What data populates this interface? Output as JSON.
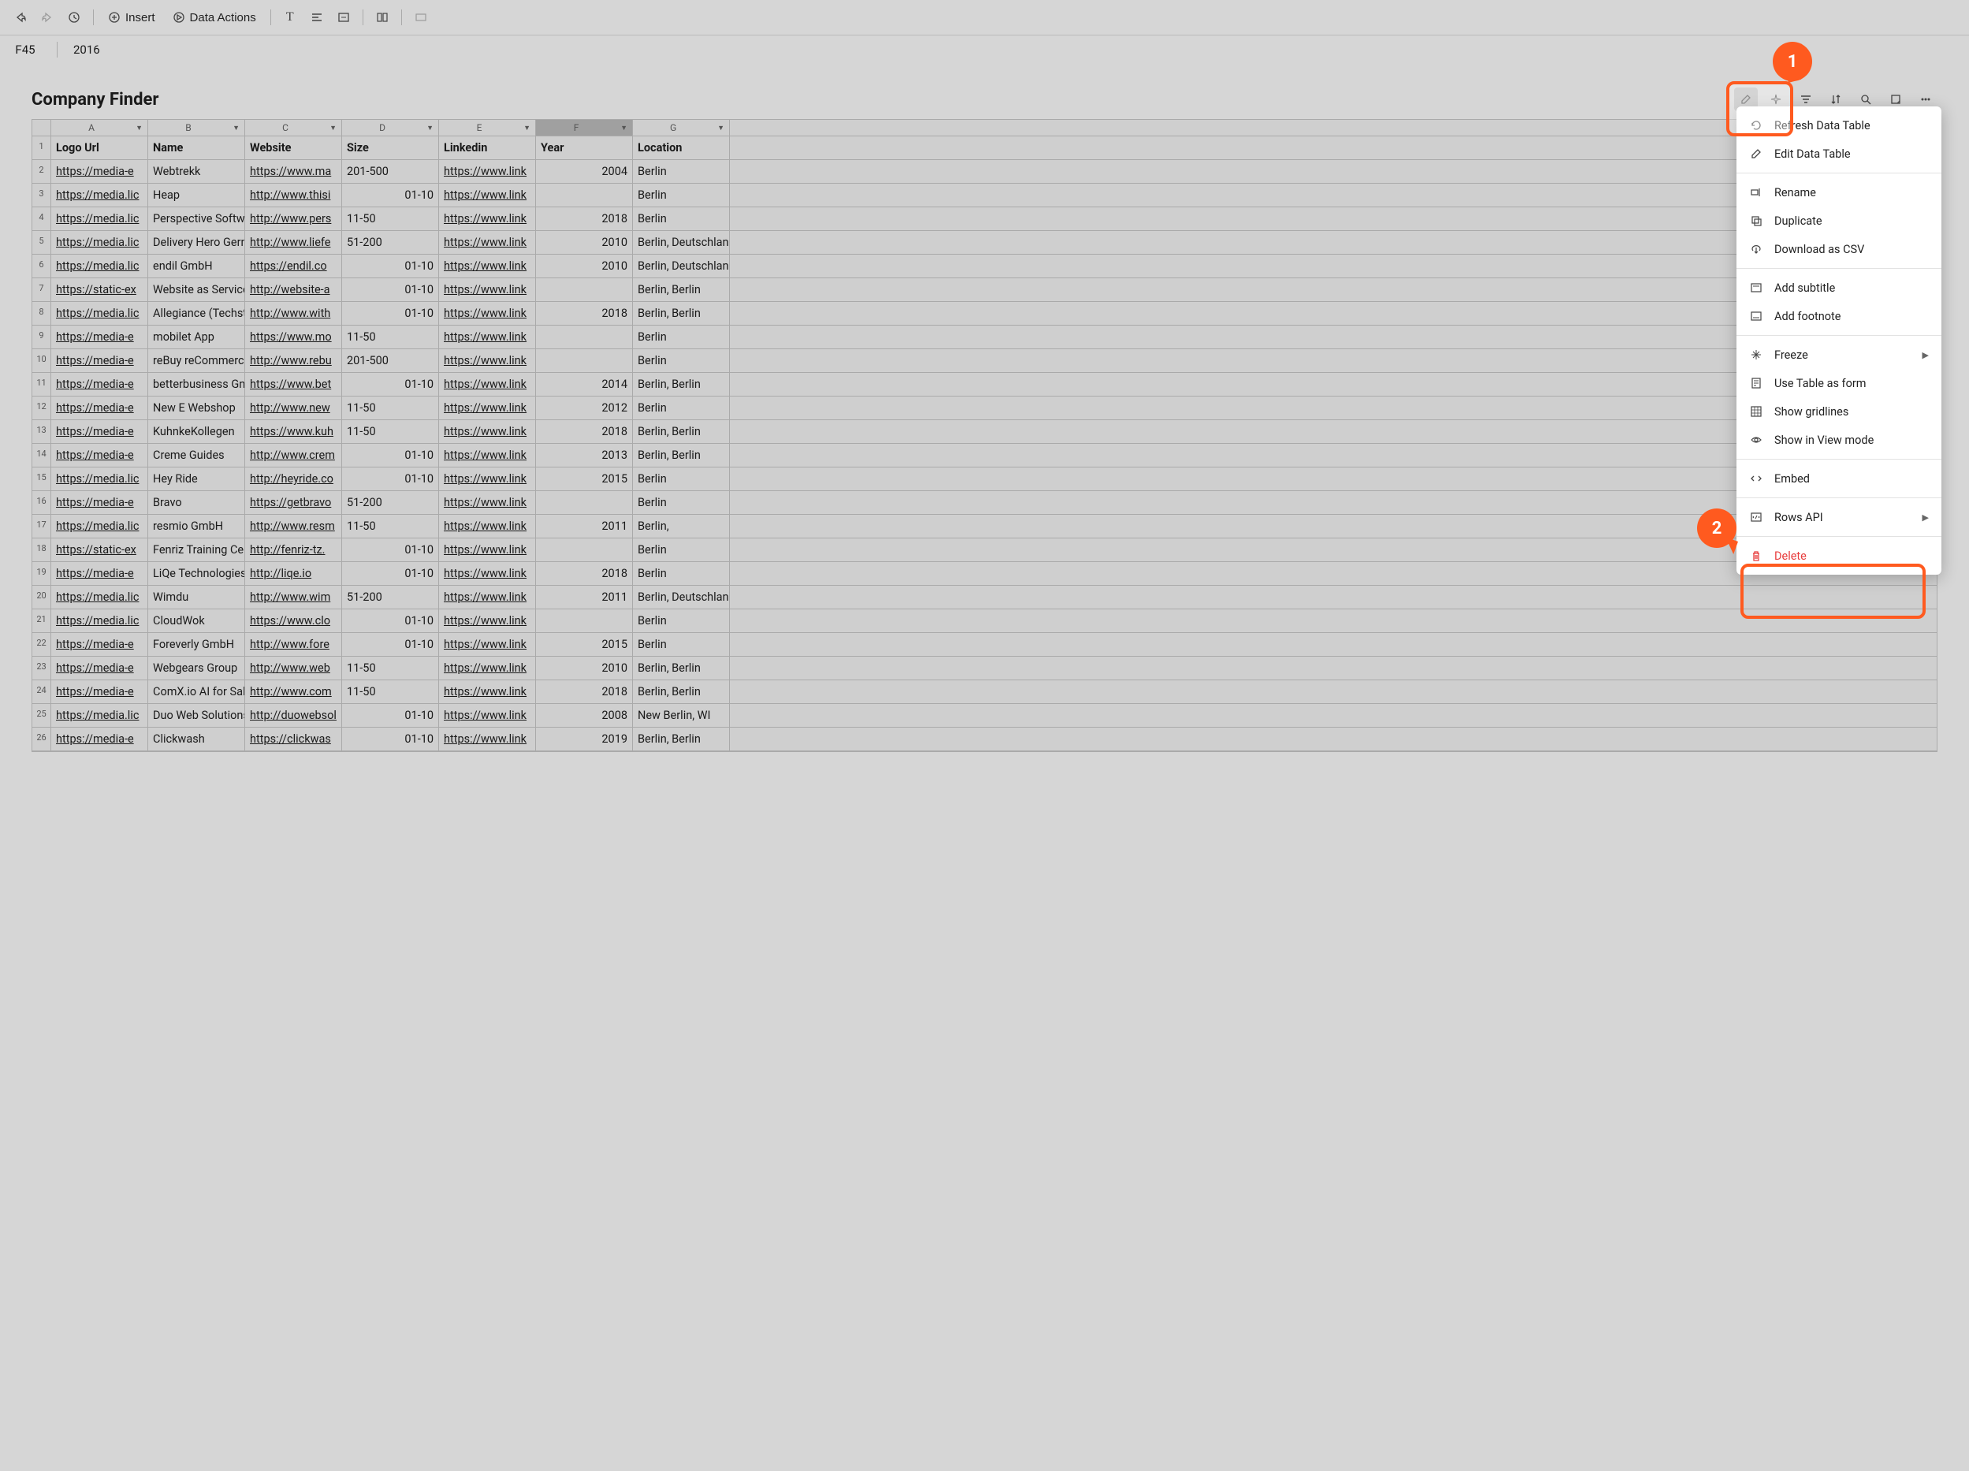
{
  "toolbar": {
    "insert_label": "Insert",
    "data_actions_label": "Data Actions"
  },
  "cell_ref": {
    "ref": "F45",
    "value": "2016"
  },
  "table": {
    "title": "Company Finder",
    "columns": [
      "A",
      "B",
      "C",
      "D",
      "E",
      "F",
      "G"
    ],
    "selected_column": "F",
    "headers": [
      "Logo Url",
      "Name",
      "Website",
      "Size",
      "Linkedin",
      "Year",
      "Location"
    ],
    "rows": [
      {
        "num": 2,
        "logo": "https://media-e",
        "name": "Webtrekk",
        "website": "https://www.ma",
        "size": "201-500",
        "linkedin": "https://www.link",
        "year": "2004",
        "location": "Berlin"
      },
      {
        "num": 3,
        "logo": "https://media.lic",
        "name": "Heap",
        "website": "http://www.thisi",
        "size": "01-10",
        "linkedin": "https://www.link",
        "year": "",
        "location": "Berlin"
      },
      {
        "num": 4,
        "logo": "https://media.lic",
        "name": "Perspective Softw",
        "website": "http://www.pers",
        "size": "11-50",
        "linkedin": "https://www.link",
        "year": "2018",
        "location": "Berlin"
      },
      {
        "num": 5,
        "logo": "https://media.lic",
        "name": "Delivery Hero Gern",
        "website": "http://www.liefe",
        "size": "51-200",
        "linkedin": "https://www.link",
        "year": "2010",
        "location": "Berlin, Deutschlan"
      },
      {
        "num": 6,
        "logo": "https://media.lic",
        "name": "endil GmbH",
        "website": "https://endil.co",
        "size": "01-10",
        "linkedin": "https://www.link",
        "year": "2010",
        "location": "Berlin, Deutschlan"
      },
      {
        "num": 7,
        "logo": "https://static-ex",
        "name": "Website as Service",
        "website": "http://website-a",
        "size": "01-10",
        "linkedin": "https://www.link",
        "year": "",
        "location": "Berlin, Berlin"
      },
      {
        "num": 8,
        "logo": "https://media.lic",
        "name": "Allegiance (Techst",
        "website": "http://www.with",
        "size": "01-10",
        "linkedin": "https://www.link",
        "year": "2018",
        "location": "Berlin, Berlin"
      },
      {
        "num": 9,
        "logo": "https://media-e",
        "name": "mobilet App",
        "website": "https://www.mo",
        "size": "11-50",
        "linkedin": "https://www.link",
        "year": "",
        "location": "Berlin"
      },
      {
        "num": 10,
        "logo": "https://media-e",
        "name": "reBuy reCommerce",
        "website": "http://www.rebu",
        "size": "201-500",
        "linkedin": "https://www.link",
        "year": "",
        "location": "Berlin"
      },
      {
        "num": 11,
        "logo": "https://media-e",
        "name": "betterbusiness Gn",
        "website": "https://www.bet",
        "size": "01-10",
        "linkedin": "https://www.link",
        "year": "2014",
        "location": "Berlin, Berlin"
      },
      {
        "num": 12,
        "logo": "https://media-e",
        "name": "New E Webshop",
        "website": "http://www.new",
        "size": "11-50",
        "linkedin": "https://www.link",
        "year": "2012",
        "location": "Berlin"
      },
      {
        "num": 13,
        "logo": "https://media-e",
        "name": "KuhnkeKollegen",
        "website": "https://www.kuh",
        "size": "11-50",
        "linkedin": "https://www.link",
        "year": "2018",
        "location": "Berlin, Berlin"
      },
      {
        "num": 14,
        "logo": "https://media-e",
        "name": "Creme Guides",
        "website": "http://www.crem",
        "size": "01-10",
        "linkedin": "https://www.link",
        "year": "2013",
        "location": "Berlin, Berlin"
      },
      {
        "num": 15,
        "logo": "https://media.lic",
        "name": "Hey Ride",
        "website": "http://heyride.co",
        "size": "01-10",
        "linkedin": "https://www.link",
        "year": "2015",
        "location": "Berlin"
      },
      {
        "num": 16,
        "logo": "https://media-e",
        "name": "Bravo",
        "website": "https://getbravo",
        "size": "51-200",
        "linkedin": "https://www.link",
        "year": "",
        "location": "Berlin"
      },
      {
        "num": 17,
        "logo": "https://media.lic",
        "name": "resmio GmbH",
        "website": "http://www.resm",
        "size": "11-50",
        "linkedin": "https://www.link",
        "year": "2011",
        "location": "Berlin,"
      },
      {
        "num": 18,
        "logo": "https://static-ex",
        "name": "Fenriz Training Cer",
        "website": "http://fenriz-tz.",
        "size": "01-10",
        "linkedin": "https://www.link",
        "year": "",
        "location": "Berlin"
      },
      {
        "num": 19,
        "logo": "https://media-e",
        "name": "LiQe Technologies",
        "website": "http://liqe.io",
        "size": "01-10",
        "linkedin": "https://www.link",
        "year": "2018",
        "location": "Berlin"
      },
      {
        "num": 20,
        "logo": "https://media.lic",
        "name": "Wimdu",
        "website": "http://www.wim",
        "size": "51-200",
        "linkedin": "https://www.link",
        "year": "2011",
        "location": "Berlin, Deutschlan"
      },
      {
        "num": 21,
        "logo": "https://media.lic",
        "name": "CloudWok",
        "website": "https://www.clo",
        "size": "01-10",
        "linkedin": "https://www.link",
        "year": "",
        "location": "Berlin"
      },
      {
        "num": 22,
        "logo": "https://media-e",
        "name": "Foreverly GmbH",
        "website": "http://www.fore",
        "size": "01-10",
        "linkedin": "https://www.link",
        "year": "2015",
        "location": "Berlin"
      },
      {
        "num": 23,
        "logo": "https://media-e",
        "name": "Webgears Group",
        "website": "http://www.web",
        "size": "11-50",
        "linkedin": "https://www.link",
        "year": "2010",
        "location": "Berlin, Berlin"
      },
      {
        "num": 24,
        "logo": "https://media-e",
        "name": "ComX.io AI for Sal",
        "website": "http://www.com",
        "size": "11-50",
        "linkedin": "https://www.link",
        "year": "2018",
        "location": "Berlin, Berlin"
      },
      {
        "num": 25,
        "logo": "https://media.lic",
        "name": "Duo Web Solutions",
        "website": "http://duowebsol",
        "size": "01-10",
        "linkedin": "https://www.link",
        "year": "2008",
        "location": "New Berlin, WI"
      },
      {
        "num": 26,
        "logo": "https://media-e",
        "name": "Clickwash",
        "website": "https://clickwas",
        "size": "01-10",
        "linkedin": "https://www.link",
        "year": "2019",
        "location": "Berlin, Berlin"
      }
    ]
  },
  "menu": {
    "refresh": "Refresh Data Table",
    "edit": "Edit Data Table",
    "rename": "Rename",
    "duplicate": "Duplicate",
    "download": "Download as CSV",
    "subtitle": "Add subtitle",
    "footnote": "Add footnote",
    "freeze": "Freeze",
    "use_form": "Use Table as form",
    "gridlines": "Show gridlines",
    "viewmode": "Show in View mode",
    "embed": "Embed",
    "rowsapi": "Rows API",
    "delete": "Delete",
    "toggles": {
      "use_form": false,
      "gridlines": true,
      "viewmode": true
    }
  },
  "callouts": {
    "one": "1",
    "two": "2"
  }
}
